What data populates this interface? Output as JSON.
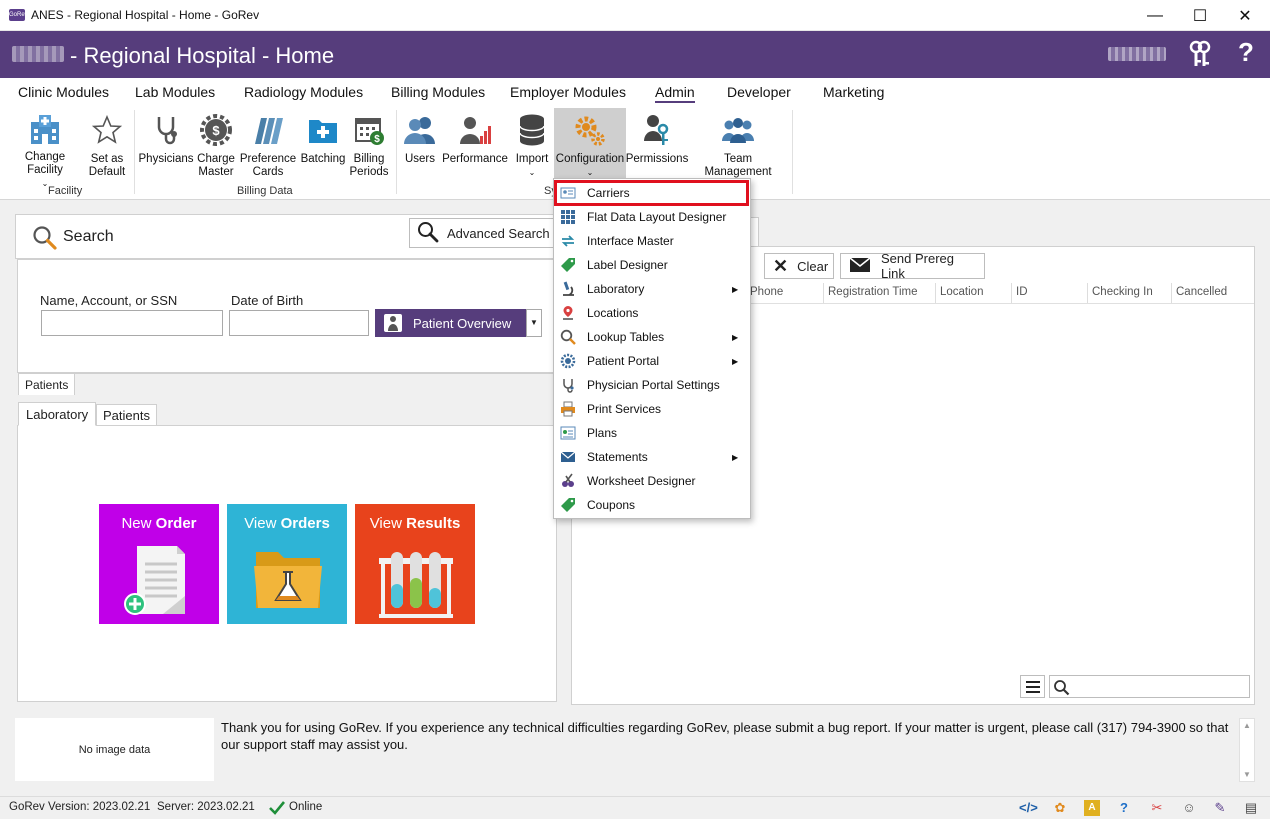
{
  "window": {
    "title": "ANES - Regional Hospital - Home - GoRev",
    "logo_text": "GoRev",
    "minimize": "—",
    "maximize": "☐",
    "close": "✕"
  },
  "header": {
    "title": "- Regional Hospital - Home",
    "help": "?"
  },
  "menu_tabs": [
    "Clinic Modules",
    "Lab Modules",
    "Radiology Modules",
    "Billing Modules",
    "Employer Modules",
    "Admin",
    "Developer",
    "Marketing"
  ],
  "ribbon": {
    "change_facility": "Change Facility",
    "set_as_default": "Set as Default",
    "facility_group": "Facility",
    "physicians": "Physicians",
    "charge_master": "Charge Master",
    "preference_cards": "Preference Cards",
    "batching": "Batching",
    "billing_periods": "Billing Periods",
    "billing_data_group": "Billing Data",
    "users": "Users",
    "performance": "Performance",
    "import": "Import",
    "configuration": "Configuration",
    "permissions": "Permissions",
    "team_management": "Team Management",
    "system_group_partial": "Sy"
  },
  "search": {
    "label": "Search",
    "advanced_label": "Advanced Search",
    "name_label": "Name, Account, or SSN",
    "dob_label": "Date of Birth",
    "name_value": "",
    "dob_value": "",
    "patient_overview": "Patient Overview"
  },
  "tabs": {
    "patients_top": "Patients",
    "laboratory": "Laboratory",
    "patients_bottom": "Patients"
  },
  "tiles": {
    "new_order_a": "New ",
    "new_order_b": "Order",
    "view_orders_a": "View ",
    "view_orders_b": "Orders",
    "view_results_a": "View ",
    "view_results_b": "Results",
    "colors": {
      "new": "#c000e8",
      "orders": "#2eb4d6",
      "results": "#e8431c"
    }
  },
  "right_panel": {
    "clear": "Clear",
    "send_prereg": "Send Prereg Link",
    "columns": [
      "Phone",
      "Registration Time",
      "Location",
      "ID",
      "Checking In",
      "Cancelled"
    ]
  },
  "dropdown": {
    "items": [
      {
        "label": "Carriers",
        "submenu": false
      },
      {
        "label": "Flat Data Layout Designer",
        "submenu": false
      },
      {
        "label": "Interface Master",
        "submenu": false
      },
      {
        "label": "Label Designer",
        "submenu": false
      },
      {
        "label": "Laboratory",
        "submenu": true
      },
      {
        "label": "Locations",
        "submenu": false
      },
      {
        "label": "Lookup Tables",
        "submenu": true
      },
      {
        "label": "Patient Portal",
        "submenu": true
      },
      {
        "label": "Physician Portal Settings",
        "submenu": false
      },
      {
        "label": "Print Services",
        "submenu": false
      },
      {
        "label": "Plans",
        "submenu": false
      },
      {
        "label": "Statements",
        "submenu": true
      },
      {
        "label": "Worksheet Designer",
        "submenu": false
      },
      {
        "label": "Coupons",
        "submenu": false
      }
    ],
    "highlight_color": "#e0101e"
  },
  "notice": {
    "no_image": "No image data",
    "text": "Thank you for using GoRev.  If you experience any technical difficulties regarding GoRev, please submit a bug report.  If your matter is urgent, please call (317) 794-3900 so that our support staff may assist you."
  },
  "status": {
    "version": "GoRev Version: 2023.02.21",
    "server": "Server: 2023.02.21",
    "online": "Online"
  },
  "colors": {
    "brand": "#563d7c",
    "online_check": "#1f8f3a"
  }
}
